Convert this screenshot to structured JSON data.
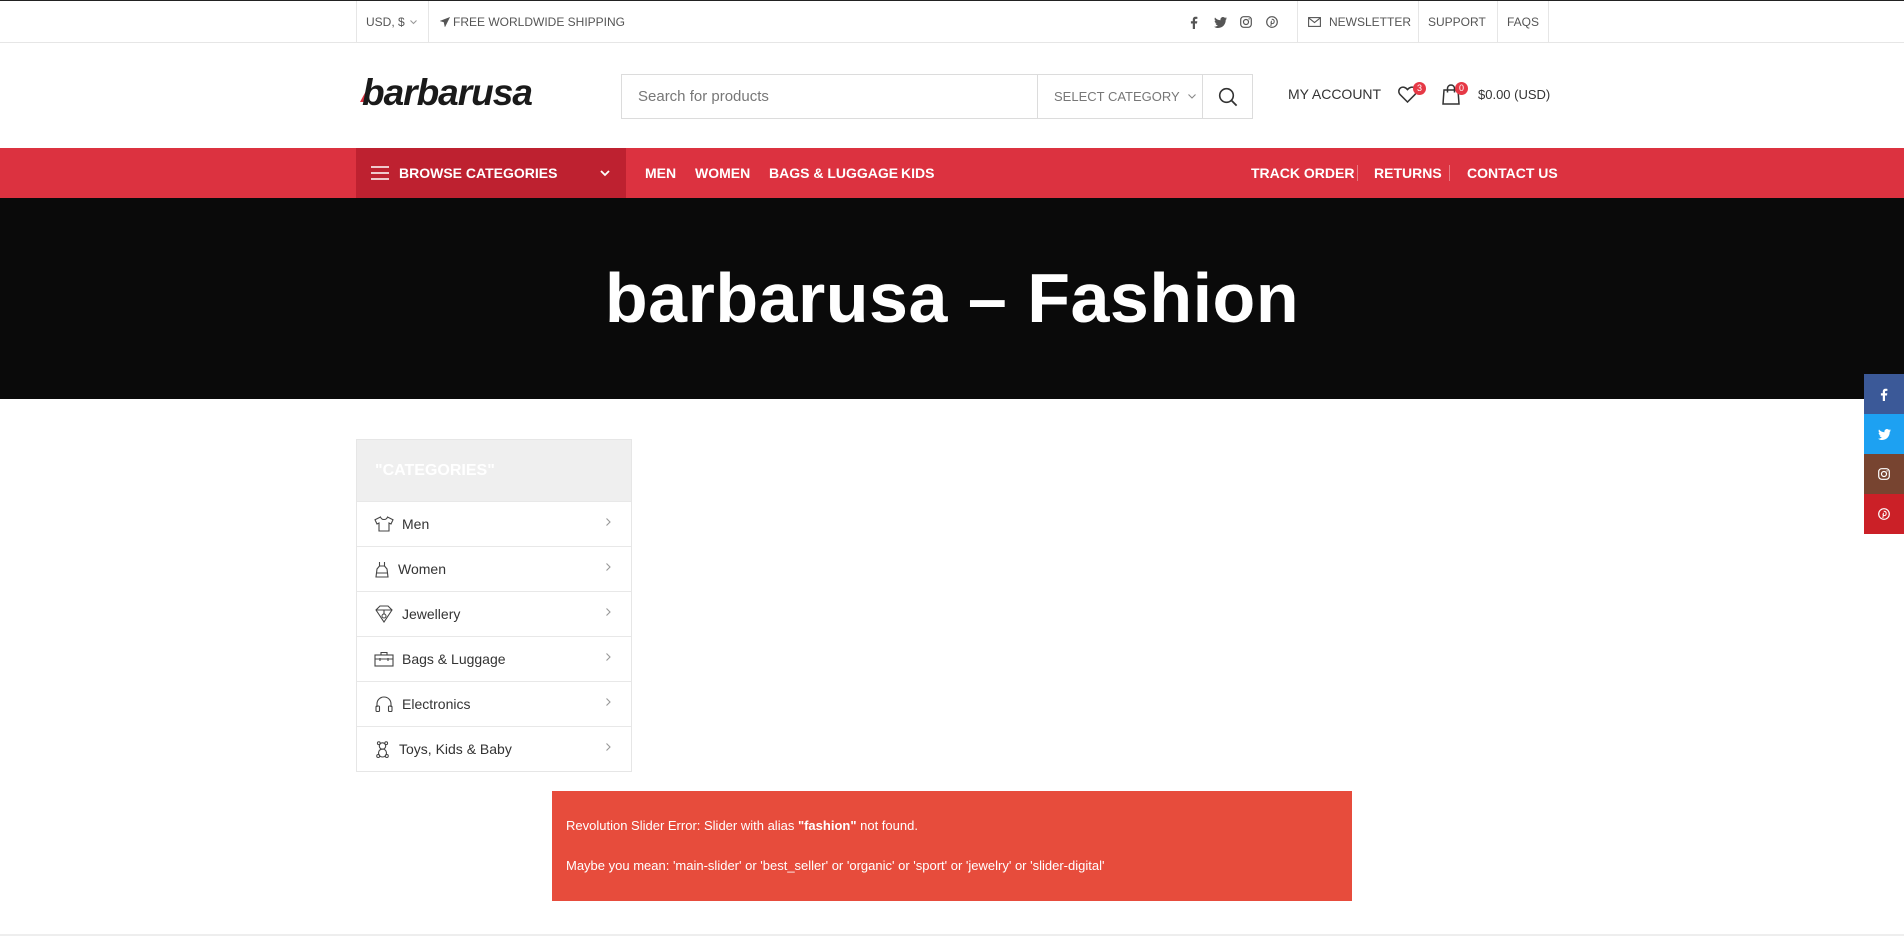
{
  "topbar": {
    "currency": "USD, $",
    "shipping": "FREE WORLDWIDE SHIPPING",
    "links": [
      "NEWSLETTER",
      "SUPPORT",
      "FAQS"
    ],
    "social_icons": [
      "facebook-icon",
      "twitter-icon",
      "instagram-icon",
      "pinterest-icon"
    ]
  },
  "header": {
    "logo_text": "barbarusa",
    "search": {
      "placeholder": "Search for products",
      "category": "SELECT CATEGORY"
    },
    "my_account": "MY ACCOUNT",
    "wishlist_count": "3",
    "cart_count": "0",
    "cart_total": "$0.00 (USD)"
  },
  "nav": {
    "browse": "BROWSE CATEGORIES",
    "main": [
      "MEN",
      "WOMEN",
      "BAGS & LUGGAGE",
      "KIDS"
    ],
    "right": [
      "TRACK ORDER",
      "RETURNS",
      "CONTACT US"
    ]
  },
  "hero": {
    "title": "barbarusa – Fashion"
  },
  "sidebar": {
    "title": "\"CATEGORIES\"",
    "items": [
      {
        "label": "Men",
        "icon": "tshirt-icon"
      },
      {
        "label": "Women",
        "icon": "dress-icon"
      },
      {
        "label": "Jewellery",
        "icon": "jewel-icon"
      },
      {
        "label": "Bags & Luggage",
        "icon": "bag-icon"
      },
      {
        "label": "Electronics",
        "icon": "headphones-icon"
      },
      {
        "label": "Toys, Kids & Baby",
        "icon": "teddy-bear-icon"
      }
    ]
  },
  "error": {
    "line1_prefix": "Revolution Slider Error: Slider with alias ",
    "line1_alias": "\"fashion\"",
    "line1_suffix": " not found.",
    "line2": "Maybe you mean: 'main-slider' or 'best_seller' or 'organic' or 'sport' or 'jewelry' or 'slider-digital'"
  },
  "colors": {
    "brand_red": "#dc3240",
    "browse_red": "#be2130",
    "error_red": "#e74c3c",
    "facebook": "#3b5998",
    "twitter": "#1da1f2",
    "instagram": "#774430",
    "pinterest": "#cb2027"
  }
}
